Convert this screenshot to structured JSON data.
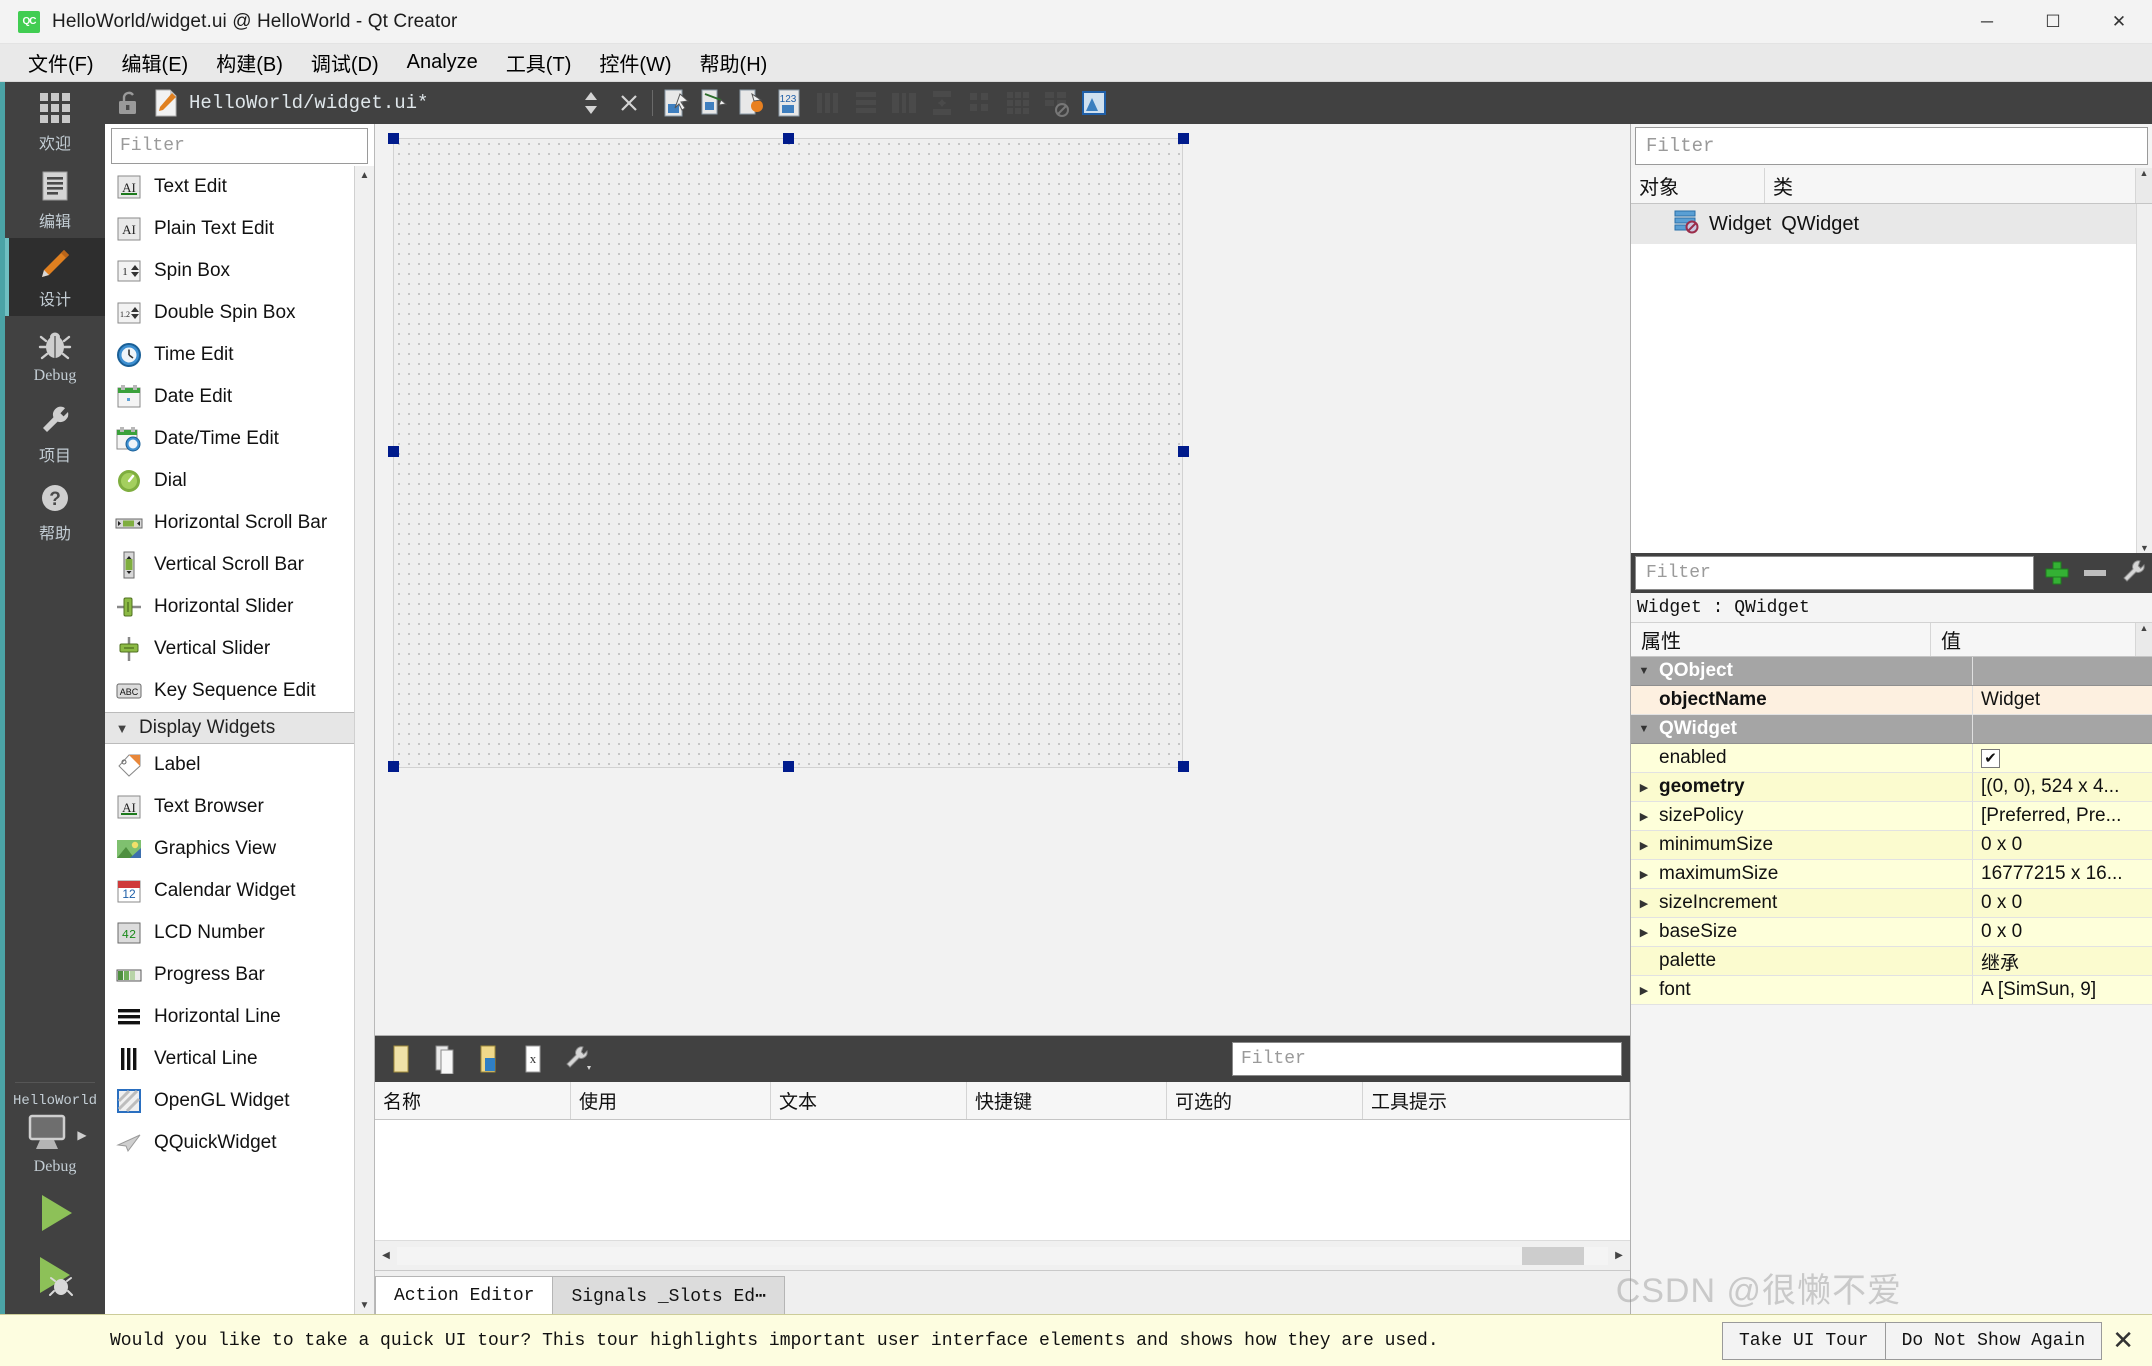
{
  "window": {
    "title": "HelloWorld/widget.ui @ HelloWorld - Qt Creator",
    "app_icon": "qt-creator-icon",
    "minimize": "─",
    "maximize": "☐",
    "close": "✕"
  },
  "menubar": [
    {
      "label": "文件(F)",
      "mnemonic": "F"
    },
    {
      "label": "编辑(E)",
      "mnemonic": "E"
    },
    {
      "label": "构建(B)",
      "mnemonic": "B"
    },
    {
      "label": "调试(D)",
      "mnemonic": "D"
    },
    {
      "label": "Analyze",
      "mnemonic": "A"
    },
    {
      "label": "工具(T)",
      "mnemonic": "T"
    },
    {
      "label": "控件(W)",
      "mnemonic": "W"
    },
    {
      "label": "帮助(H)",
      "mnemonic": "H"
    }
  ],
  "modebar": {
    "items": [
      {
        "label": "欢迎",
        "icon": "grid-icon",
        "active": false
      },
      {
        "label": "编辑",
        "icon": "document-lines-icon",
        "active": false
      },
      {
        "label": "设计",
        "icon": "pencil-icon",
        "active": true
      },
      {
        "label": "Debug",
        "icon": "bug-icon",
        "active": false
      },
      {
        "label": "项目",
        "icon": "wrench-icon",
        "active": false
      },
      {
        "label": "帮助",
        "icon": "question-circle-icon",
        "active": false
      }
    ],
    "kit": {
      "project": "HelloWorld",
      "build_config": "Debug",
      "target_icon": "monitor-icon",
      "run_icon": "play-triangle-icon",
      "debug_icon": "play-bug-icon"
    }
  },
  "editor_toolbar": {
    "lock_icon": "unlocked-padlock-icon",
    "file_icon": "ui-file-icon",
    "file_name": "HelloWorld/widget.ui*",
    "split_icon": "updown-arrows-icon",
    "close_icon": "close-x-icon",
    "designer_tools": [
      {
        "icon": "edit-widgets-icon",
        "name": "edit-widgets"
      },
      {
        "icon": "edit-signals-slots-icon",
        "name": "edit-signals-slots"
      },
      {
        "icon": "edit-buddies-icon",
        "name": "edit-buddies"
      },
      {
        "icon": "edit-tab-order-icon",
        "name": "edit-tab-order"
      },
      {
        "icon": "layout-horizontal-icon",
        "name": "lay-out-horizontally"
      },
      {
        "icon": "layout-vertical-icon",
        "name": "lay-out-vertically"
      },
      {
        "icon": "layout-splitter-h-icon",
        "name": "lay-out-h-splitter"
      },
      {
        "icon": "layout-splitter-v-icon",
        "name": "lay-out-v-splitter"
      },
      {
        "icon": "layout-form-icon",
        "name": "lay-out-in-form"
      },
      {
        "icon": "layout-grid-icon",
        "name": "lay-out-in-grid"
      },
      {
        "icon": "break-layout-icon",
        "name": "break-layout"
      },
      {
        "icon": "adjust-size-icon",
        "name": "adjust-size"
      }
    ]
  },
  "widgetbox": {
    "filter_placeholder": "Filter",
    "items": [
      {
        "label": "Text Edit",
        "icon": "text-edit-icon",
        "type": "item"
      },
      {
        "label": "Plain Text Edit",
        "icon": "plain-text-edit-icon",
        "type": "item"
      },
      {
        "label": "Spin Box",
        "icon": "spin-box-icon",
        "type": "item"
      },
      {
        "label": "Double Spin Box",
        "icon": "double-spin-box-icon",
        "type": "item"
      },
      {
        "label": "Time Edit",
        "icon": "clock-icon",
        "type": "item"
      },
      {
        "label": "Date Edit",
        "icon": "calendar-icon",
        "type": "item"
      },
      {
        "label": "Date/Time Edit",
        "icon": "calendar-clock-icon",
        "type": "item"
      },
      {
        "label": "Dial",
        "icon": "dial-knob-icon",
        "type": "item"
      },
      {
        "label": "Horizontal Scroll Bar",
        "icon": "h-scrollbar-icon",
        "type": "item"
      },
      {
        "label": "Vertical Scroll Bar",
        "icon": "v-scrollbar-icon",
        "type": "item"
      },
      {
        "label": "Horizontal Slider",
        "icon": "h-slider-icon",
        "type": "item"
      },
      {
        "label": "Vertical Slider",
        "icon": "v-slider-icon",
        "type": "item"
      },
      {
        "label": "Key Sequence Edit",
        "icon": "key-sequence-icon",
        "type": "item"
      },
      {
        "label": "Display Widgets",
        "icon": "chevron-down-icon",
        "type": "category"
      },
      {
        "label": "Label",
        "icon": "label-tag-icon",
        "type": "item"
      },
      {
        "label": "Text Browser",
        "icon": "text-browser-icon",
        "type": "item"
      },
      {
        "label": "Graphics View",
        "icon": "graphics-view-icon",
        "type": "item"
      },
      {
        "label": "Calendar Widget",
        "icon": "calendar-12-icon",
        "type": "item"
      },
      {
        "label": "LCD Number",
        "icon": "lcd-number-icon",
        "type": "item"
      },
      {
        "label": "Progress Bar",
        "icon": "progress-bar-icon",
        "type": "item"
      },
      {
        "label": "Horizontal Line",
        "icon": "h-line-icon",
        "type": "item"
      },
      {
        "label": "Vertical Line",
        "icon": "v-line-icon",
        "type": "item"
      },
      {
        "label": "OpenGL Widget",
        "icon": "opengl-widget-icon",
        "type": "item"
      },
      {
        "label": "QQuickWidget",
        "icon": "qquickwidget-icon",
        "type": "item"
      }
    ]
  },
  "action_editor": {
    "toolbar_icons": [
      {
        "icon": "new-action-icon",
        "name": "new-action"
      },
      {
        "icon": "copy-action-icon",
        "name": "copy-action"
      },
      {
        "icon": "paste-action-icon",
        "name": "paste-action"
      },
      {
        "icon": "delete-action-icon",
        "name": "delete-action"
      },
      {
        "icon": "view-mode-icon",
        "name": "view-mode"
      }
    ],
    "filter_placeholder": "Filter",
    "columns": [
      "名称",
      "使用",
      "文本",
      "快捷键",
      "可选的",
      "工具提示"
    ],
    "rows": [],
    "tabs": [
      {
        "label": "Action Editor",
        "active": true
      },
      {
        "label": "Signals _Slots Ed⋯",
        "active": false
      }
    ]
  },
  "object_inspector": {
    "filter_placeholder": "Filter",
    "columns": [
      "对象",
      "类"
    ],
    "rows": [
      {
        "object": "Widget",
        "class": "QWidget",
        "icon": "qwidget-icon"
      }
    ]
  },
  "property_editor": {
    "filter_placeholder": "Filter",
    "toolbar_icons": [
      {
        "icon": "plus-green-icon",
        "name": "add-dynamic-property"
      },
      {
        "icon": "minus-icon",
        "name": "remove-dynamic-property"
      },
      {
        "icon": "configure-icon",
        "name": "configure-view"
      }
    ],
    "object_line": "Widget : QWidget",
    "columns": [
      "属性",
      "值"
    ],
    "rows": [
      {
        "name": "QObject",
        "value": "",
        "kind": "group",
        "expanded": true
      },
      {
        "name": "objectName",
        "value": "Widget",
        "kind": "highlight"
      },
      {
        "name": "QWidget",
        "value": "",
        "kind": "group",
        "expanded": true
      },
      {
        "name": "enabled",
        "value": "",
        "kind": "check",
        "checked": true
      },
      {
        "name": "geometry",
        "value": "[(0, 0), 524 x 4...",
        "kind": "bold-expand"
      },
      {
        "name": "sizePolicy",
        "value": "[Preferred, Pre...",
        "kind": "expand"
      },
      {
        "name": "minimumSize",
        "value": "0 x 0",
        "kind": "expand"
      },
      {
        "name": "maximumSize",
        "value": "16777215 x 16...",
        "kind": "expand"
      },
      {
        "name": "sizeIncrement",
        "value": "0 x 0",
        "kind": "expand"
      },
      {
        "name": "baseSize",
        "value": "0 x 0",
        "kind": "expand"
      },
      {
        "name": "palette",
        "value": "继承",
        "kind": "plain"
      },
      {
        "name": "font",
        "value": "A  [SimSun, 9]",
        "kind": "expand"
      }
    ]
  },
  "tour_bar": {
    "message": "Would you like to take a quick UI tour? This tour highlights important user interface elements and shows how they are used.",
    "take_tour": "Take UI Tour",
    "dont_show": "Do Not Show Again",
    "close": "✕"
  },
  "watermark": "CSDN @很懒不爱",
  "colors": {
    "accent_teal": "#4ba3a6",
    "modebar_bg": "#414141",
    "qt_green": "#41cd52",
    "handle_blue": "#001b8c",
    "property_yellow": "#feffda",
    "property_peach": "#fdf0e0"
  }
}
